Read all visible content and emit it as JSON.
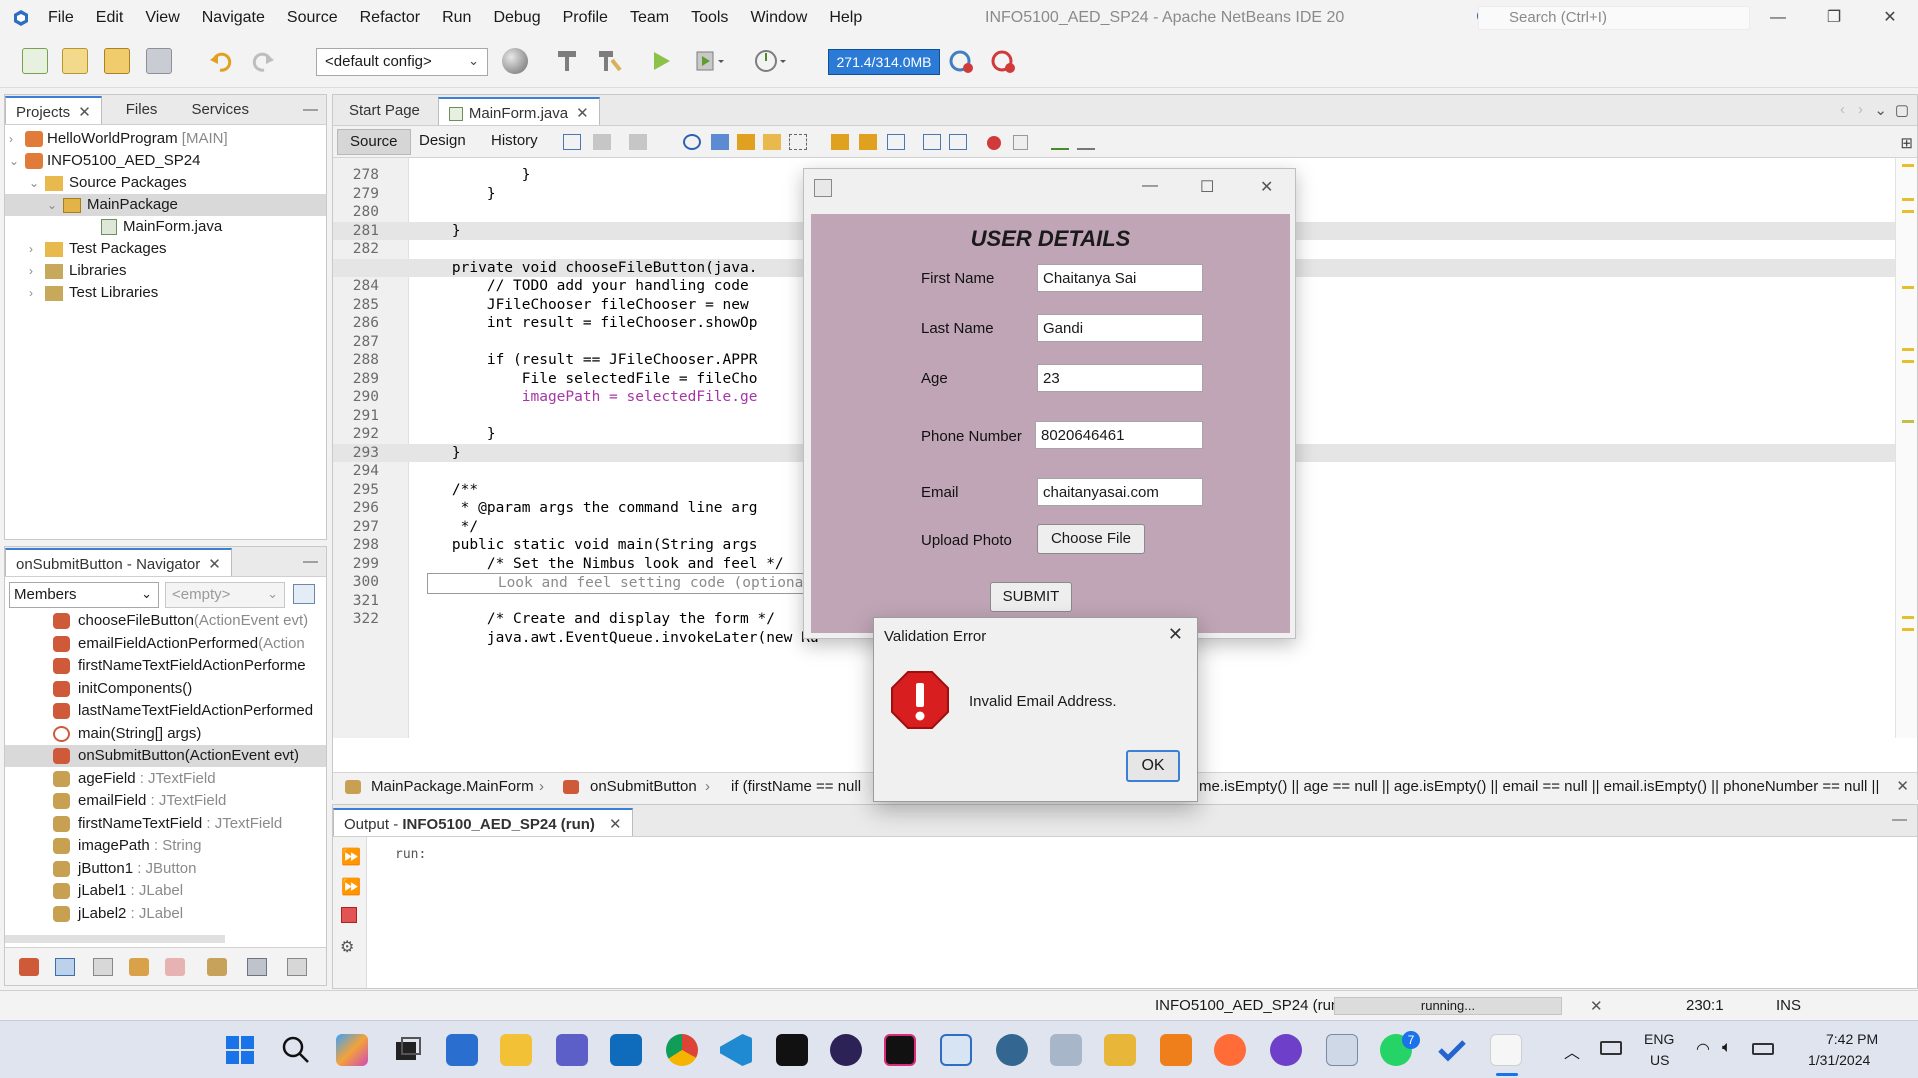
{
  "window": {
    "title": "INFO5100_AED_SP24 - Apache NetBeans IDE 20",
    "menu": [
      "File",
      "Edit",
      "View",
      "Navigate",
      "Source",
      "Refactor",
      "Run",
      "Debug",
      "Profile",
      "Team",
      "Tools",
      "Window",
      "Help"
    ],
    "search_placeholder": "Search (Ctrl+I)"
  },
  "toolbar": {
    "config_value": "<default config>",
    "memory": "271.4/314.0MB"
  },
  "projects_panel": {
    "tabs": [
      "Projects",
      "Files",
      "Services"
    ],
    "tree": [
      {
        "label": "HelloWorldProgram",
        "suffix": "[MAIN]"
      },
      {
        "label": "INFO5100_AED_SP24"
      },
      {
        "label": "Source Packages"
      },
      {
        "label": "MainPackage"
      },
      {
        "label": "MainForm.java"
      },
      {
        "label": "Test Packages"
      },
      {
        "label": "Libraries"
      },
      {
        "label": "Test Libraries"
      }
    ]
  },
  "navigator": {
    "title": "onSubmitButton - Navigator",
    "filter_value": "Members",
    "filter2_value": "<empty>",
    "items": [
      {
        "name": "chooseFileButton",
        "type": "(ActionEvent evt)"
      },
      {
        "name": "emailFieldActionPerformed",
        "type": "(Action"
      },
      {
        "name": "firstNameTextFieldActionPerforme",
        "type": ""
      },
      {
        "name": "initComponents()",
        "type": ""
      },
      {
        "name": "lastNameTextFieldActionPerformed",
        "type": ""
      },
      {
        "name": "main(String[] args)",
        "type": ""
      },
      {
        "name": "onSubmitButton(ActionEvent evt)",
        "type": ""
      },
      {
        "name": "ageField",
        "type": " : JTextField"
      },
      {
        "name": "emailField",
        "type": " : JTextField"
      },
      {
        "name": "firstNameTextField",
        "type": " : JTextField"
      },
      {
        "name": "imagePath",
        "type": " : String"
      },
      {
        "name": "jButton1",
        "type": " : JButton"
      },
      {
        "name": "jLabel1",
        "type": " : JLabel"
      },
      {
        "name": "jLabel2",
        "type": " : JLabel"
      }
    ]
  },
  "editor": {
    "tabs": [
      "Start Page",
      "MainForm.java"
    ],
    "subtabs": [
      "Source",
      "Design",
      "History"
    ],
    "lines": [
      {
        "num": "278",
        "code": "            }"
      },
      {
        "num": "279",
        "code": "        }"
      },
      {
        "num": "280",
        "code": ""
      },
      {
        "num": "281",
        "code": "    }"
      },
      {
        "num": "282",
        "code": ""
      },
      {
        "num": "",
        "code": "    private void chooseFileButton(java."
      },
      {
        "num": "284",
        "code": "        // TODO add your handling code"
      },
      {
        "num": "285",
        "code": "        JFileChooser fileChooser = new"
      },
      {
        "num": "286",
        "code": "        int result = fileChooser.showOp"
      },
      {
        "num": "287",
        "code": ""
      },
      {
        "num": "288",
        "code": "        if (result == JFileChooser.APPR"
      },
      {
        "num": "289",
        "code": "            File selectedFile = fileCho"
      },
      {
        "num": "290",
        "code": "            imagePath = selectedFile.ge"
      },
      {
        "num": "291",
        "code": ""
      },
      {
        "num": "292",
        "code": "        }"
      },
      {
        "num": "293",
        "code": "    }"
      },
      {
        "num": "294",
        "code": ""
      },
      {
        "num": "295",
        "code": "    /**"
      },
      {
        "num": "296",
        "code": "     * @param args the command line arg"
      },
      {
        "num": "297",
        "code": "     */"
      },
      {
        "num": "298",
        "code": "    public static void main(String args"
      },
      {
        "num": "299",
        "code": "        /* Set the Nimbus look and feel */"
      },
      {
        "num": "300",
        "code": "        Look and feel setting code (optional)"
      },
      {
        "num": "321",
        "code": ""
      },
      {
        "num": "322",
        "code": "        /* Create and display the form */"
      },
      {
        "num": "",
        "code": "        java.awt.EventQueue.invokeLater(new Ru"
      }
    ],
    "breadcrumb": [
      "MainPackage.MainForm",
      "onSubmitButton",
      "if (firstName == null"
    ],
    "breadcrumb_tail": "me.isEmpty() || age == null || age.isEmpty() || email == null || email.isEmpty() || phoneNumber == null || "
  },
  "user_form": {
    "heading": "USER DETAILS",
    "fields": [
      {
        "label": "First Name",
        "value": "Chaitanya Sai"
      },
      {
        "label": "Last Name",
        "value": "Gandi"
      },
      {
        "label": "Age",
        "value": "23"
      },
      {
        "label": "Phone Number",
        "value": "8020646461"
      },
      {
        "label": "Email",
        "value": "chaitanyasai.com"
      }
    ],
    "upload_label": "Upload Photo",
    "choose_file_label": "Choose File",
    "submit_label": "SUBMIT",
    "bg_color": "#bfa5b6"
  },
  "dialog": {
    "title": "Validation Error",
    "message": "Invalid Email Address.",
    "ok_label": "OK"
  },
  "output": {
    "title_prefix": "Output - ",
    "title_project": "INFO5100_AED_SP24 (run)",
    "text": "run:"
  },
  "status": {
    "project": "INFO5100_AED_SP24 (run)",
    "progress": "running...",
    "position": "230:1",
    "mode": "INS"
  },
  "taskbar": {
    "lang1": "ENG",
    "lang2": "US",
    "time": "7:42 PM",
    "date": "1/31/2024",
    "badge": "7"
  }
}
